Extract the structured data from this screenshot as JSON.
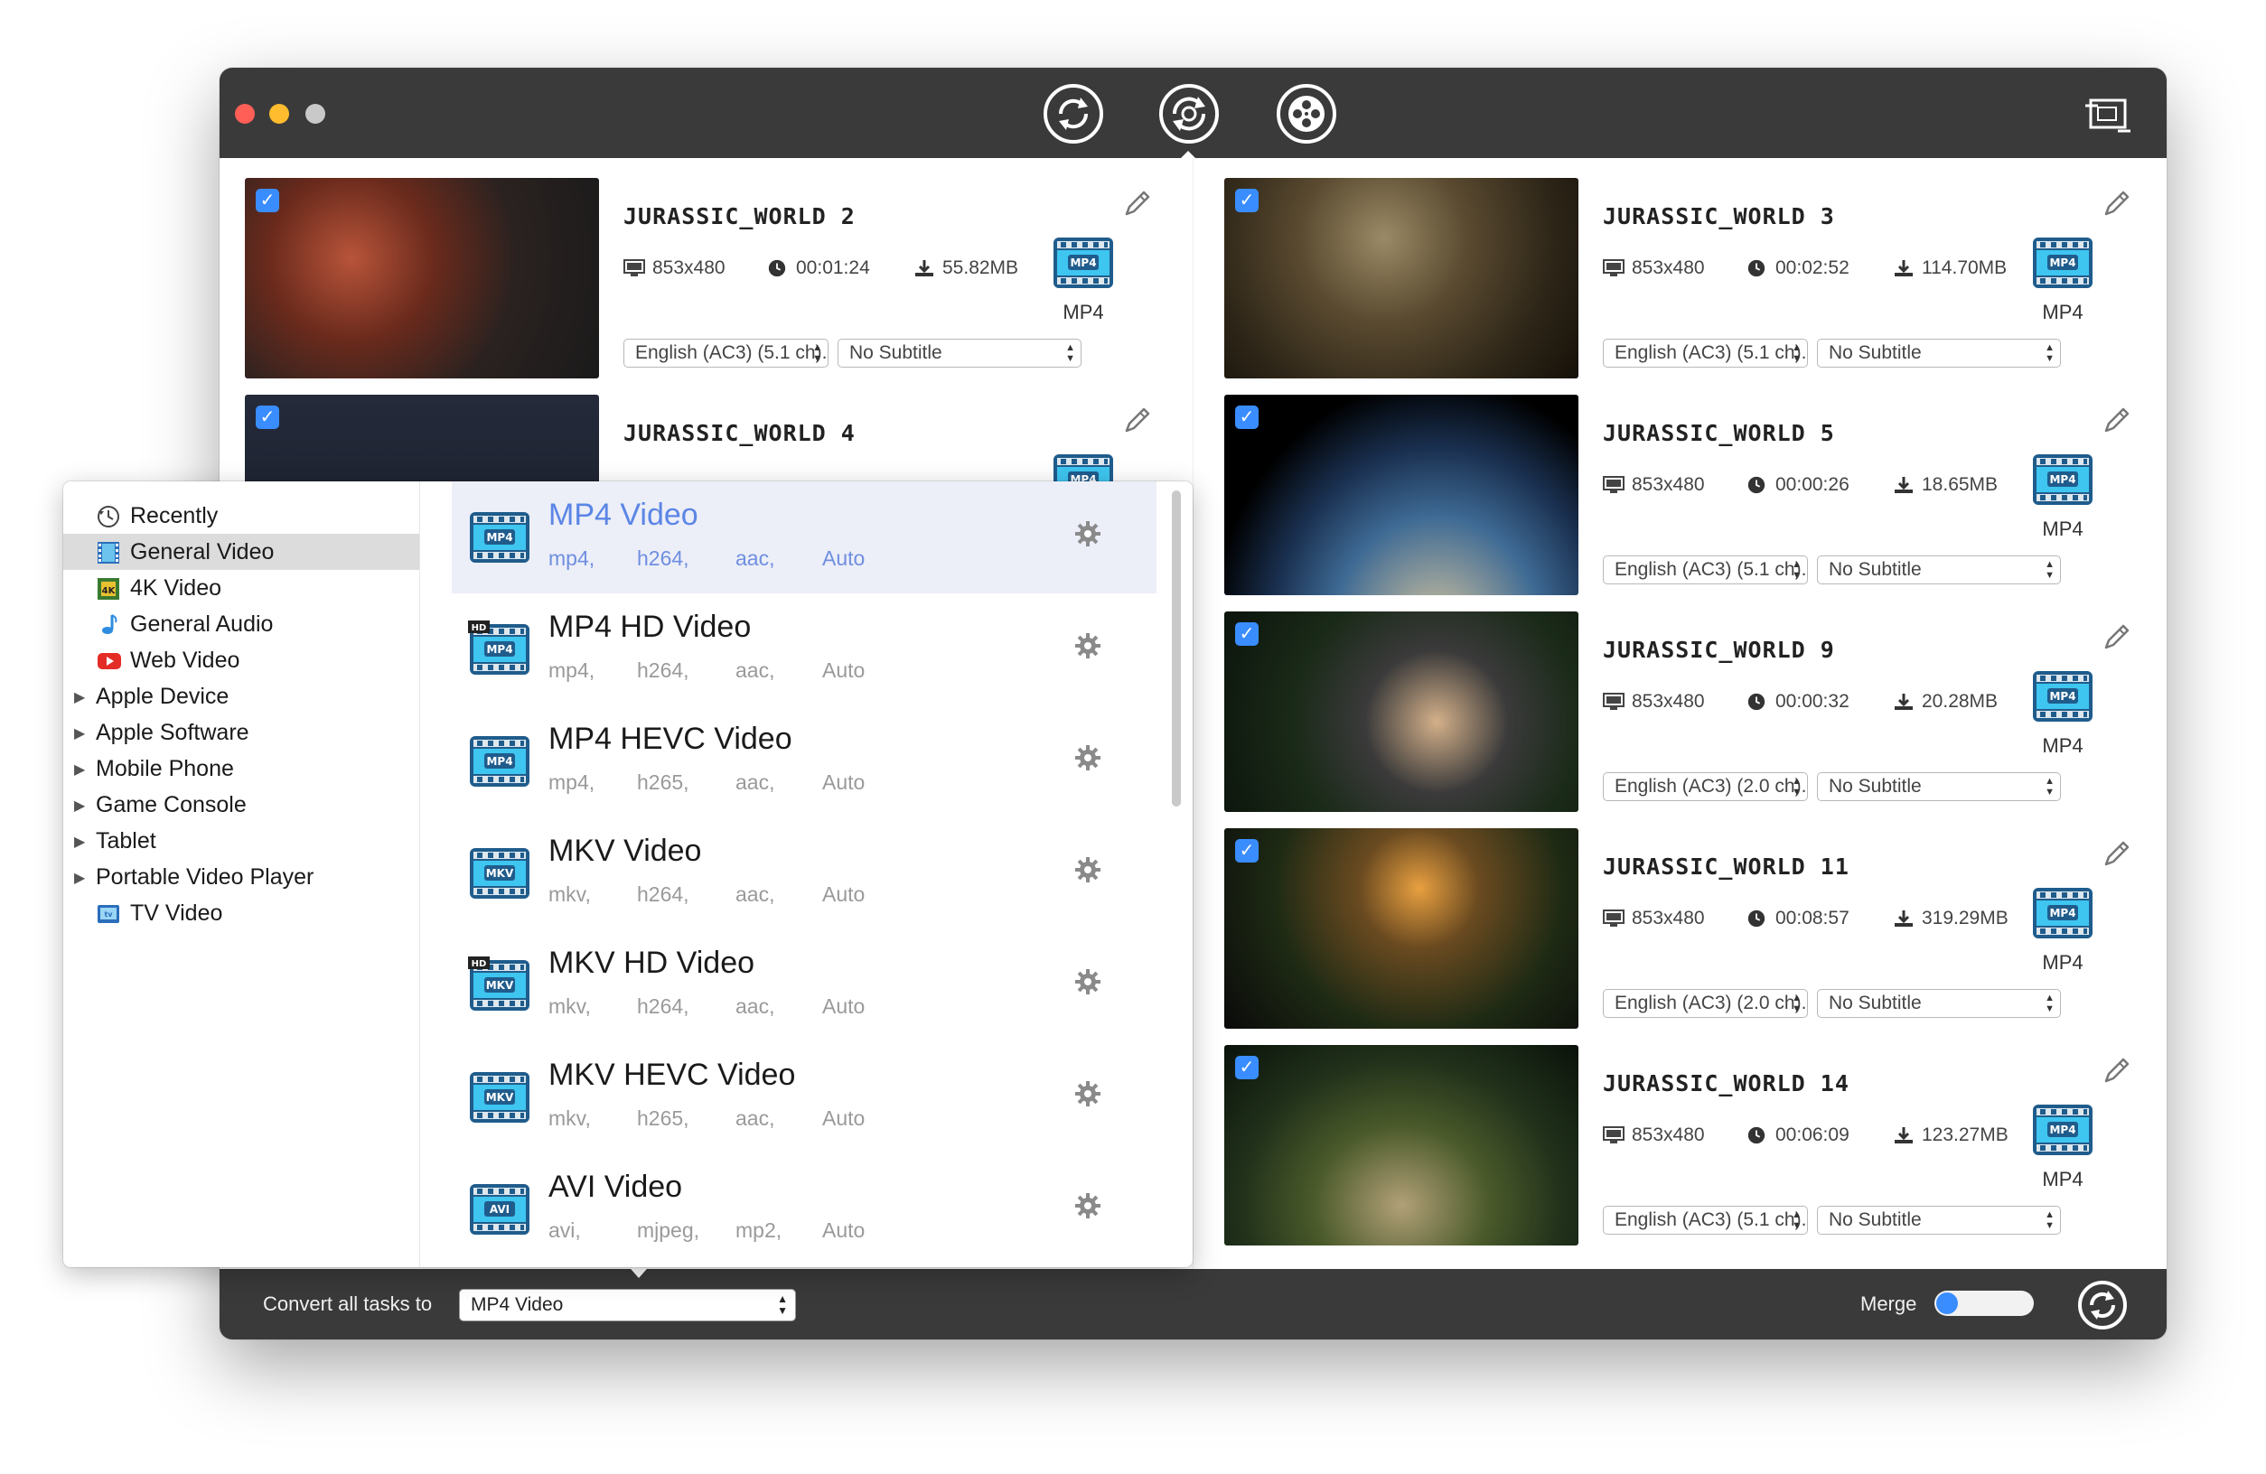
{
  "toolbar": {
    "tools": [
      "convert-icon",
      "rip-icon",
      "film-reel-icon"
    ],
    "right_tool": "crop-icon"
  },
  "videos": [
    {
      "title": "JURASSIC_WORLD 2",
      "resolution": "853x480",
      "duration": "00:01:24",
      "size": "55.82MB",
      "format": "MP4",
      "audio": "English (AC3) (5.1 ch)...",
      "subtitle": "No Subtitle",
      "checked": true
    },
    {
      "title": "JURASSIC_WORLD 3",
      "resolution": "853x480",
      "duration": "00:02:52",
      "size": "114.70MB",
      "format": "MP4",
      "audio": "English (AC3) (5.1 ch)...",
      "subtitle": "No Subtitle",
      "checked": true
    },
    {
      "title": "JURASSIC_WORLD 4",
      "checked": true
    },
    {
      "title": "JURASSIC_WORLD 5",
      "resolution": "853x480",
      "duration": "00:00:26",
      "size": "18.65MB",
      "format": "MP4",
      "audio": "English (AC3) (5.1 ch)...",
      "subtitle": "No Subtitle",
      "checked": true
    },
    {
      "title": "JURASSIC_WORLD 9",
      "resolution": "853x480",
      "duration": "00:00:32",
      "size": "20.28MB",
      "format": "MP4",
      "audio": "English (AC3) (2.0 ch)...",
      "subtitle": "No Subtitle",
      "checked": true
    },
    {
      "title": "JURASSIC_WORLD 11",
      "resolution": "853x480",
      "duration": "00:08:57",
      "size": "319.29MB",
      "format": "MP4",
      "audio": "English (AC3) (2.0 ch)...",
      "subtitle": "No Subtitle",
      "checked": true
    },
    {
      "title": "JURASSIC_WORLD 14",
      "resolution": "853x480",
      "duration": "00:06:09",
      "size": "123.27MB",
      "format": "MP4",
      "audio": "English (AC3) (5.1 ch)...",
      "subtitle": "No Subtitle",
      "checked": true
    }
  ],
  "badge_text": {
    "mp4": "MP4",
    "mkv": "MKV",
    "avi": "AVI",
    "hd": "HD"
  },
  "categories": [
    {
      "label": "Recently",
      "icon": "clock-icon"
    },
    {
      "label": "General Video",
      "icon": "film-icon",
      "selected": true
    },
    {
      "label": "4K Video",
      "icon": "4k-icon"
    },
    {
      "label": "General Audio",
      "icon": "music-note-icon"
    },
    {
      "label": "Web Video",
      "icon": "youtube-icon"
    },
    {
      "label": "Apple Device",
      "expandable": true
    },
    {
      "label": "Apple Software",
      "expandable": true
    },
    {
      "label": "Mobile Phone",
      "expandable": true
    },
    {
      "label": "Game Console",
      "expandable": true
    },
    {
      "label": "Tablet",
      "expandable": true
    },
    {
      "label": "Portable Video Player",
      "expandable": true
    },
    {
      "label": "TV Video",
      "icon": "tv-icon"
    }
  ],
  "formats": [
    {
      "name": "MP4 Video",
      "container": "mp4,",
      "video": "h264,",
      "audio": "aac,",
      "quality": "Auto",
      "badge": "MP4",
      "hd": false,
      "selected": true
    },
    {
      "name": "MP4 HD Video",
      "container": "mp4,",
      "video": "h264,",
      "audio": "aac,",
      "quality": "Auto",
      "badge": "MP4",
      "hd": true
    },
    {
      "name": "MP4 HEVC Video",
      "container": "mp4,",
      "video": "h265,",
      "audio": "aac,",
      "quality": "Auto",
      "badge": "MP4",
      "hd": false
    },
    {
      "name": "MKV Video",
      "container": "mkv,",
      "video": "h264,",
      "audio": "aac,",
      "quality": "Auto",
      "badge": "MKV",
      "hd": false
    },
    {
      "name": "MKV HD Video",
      "container": "mkv,",
      "video": "h264,",
      "audio": "aac,",
      "quality": "Auto",
      "badge": "MKV",
      "hd": true
    },
    {
      "name": "MKV HEVC Video",
      "container": "mkv,",
      "video": "h265,",
      "audio": "aac,",
      "quality": "Auto",
      "badge": "MKV",
      "hd": false
    },
    {
      "name": "AVI Video",
      "container": "avi,",
      "video": "mjpeg,",
      "audio": "mp2,",
      "quality": "Auto",
      "badge": "AVI",
      "hd": false
    }
  ],
  "bottombar": {
    "convert_label": "Convert all tasks to",
    "convert_value": "MP4 Video",
    "merge_label": "Merge",
    "merge_on": false
  },
  "colors": {
    "accent": "#3a8dff",
    "titlebar": "#3a3a3a",
    "selected_format_text": "#5b86e5"
  }
}
